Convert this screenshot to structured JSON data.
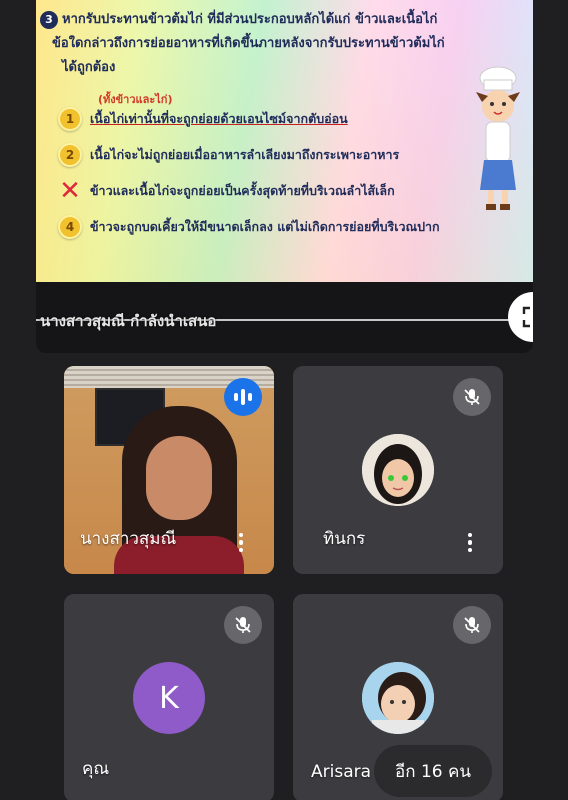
{
  "presentation": {
    "question_number": "3",
    "question_lines": [
      "หากรับประทานข้าวต้มไก่ ที่มีส่วนประกอบหลักได้แก่ ข้าวและเนื้อไก่",
      "ข้อใดกล่าวถึงการย่อยอาหารที่เกิดขึ้นภายหลังจากรับประทานข้าวต้มไก่",
      "ได้ถูกต้อง"
    ],
    "handwritten_note": "(ทั้งข้าวและไก่)",
    "options": [
      {
        "badge": "1",
        "text": "เนื้อไก่เท่านั้นที่จะถูกย่อยด้วยเอนไซม์จากตับอ่อน"
      },
      {
        "badge": "2",
        "text": "เนื้อไก่จะไม่ถูกย่อยเมื่ออาหารลำเลียงมาถึงกระเพาะอาหาร"
      },
      {
        "badge": "✕",
        "text": "ข้าวและเนื้อไก่จะถูกย่อยเป็นครั้งสุดท้ายที่บริเวณลำไส้เล็ก"
      },
      {
        "badge": "4",
        "text": "ข้าวจะถูกบดเคี้ยวให้มีขนาดเล็กลง แต่ไม่เกิดการย่อยที่บริเวณปาก"
      }
    ],
    "presenter_label": "นางสาวสุมณี กำลังนำเสนอ"
  },
  "participants": [
    {
      "name": "นางสาวสุมณี",
      "state": "speaking",
      "icon": "audio-wave-icon"
    },
    {
      "name": "ทินกร",
      "state": "muted",
      "icon": "mic-off-icon"
    },
    {
      "name": "คุณ",
      "initial": "K",
      "state": "muted",
      "icon": "mic-off-icon",
      "avatar_color": "#8e5bc8"
    },
    {
      "name": "Arisara",
      "state": "muted",
      "icon": "mic-off-icon"
    }
  ],
  "more_participants": "อีก 16 คน",
  "colors": {
    "background": "#1f1f22",
    "tile": "#3c3c40",
    "speaking": "#1a73e8"
  }
}
